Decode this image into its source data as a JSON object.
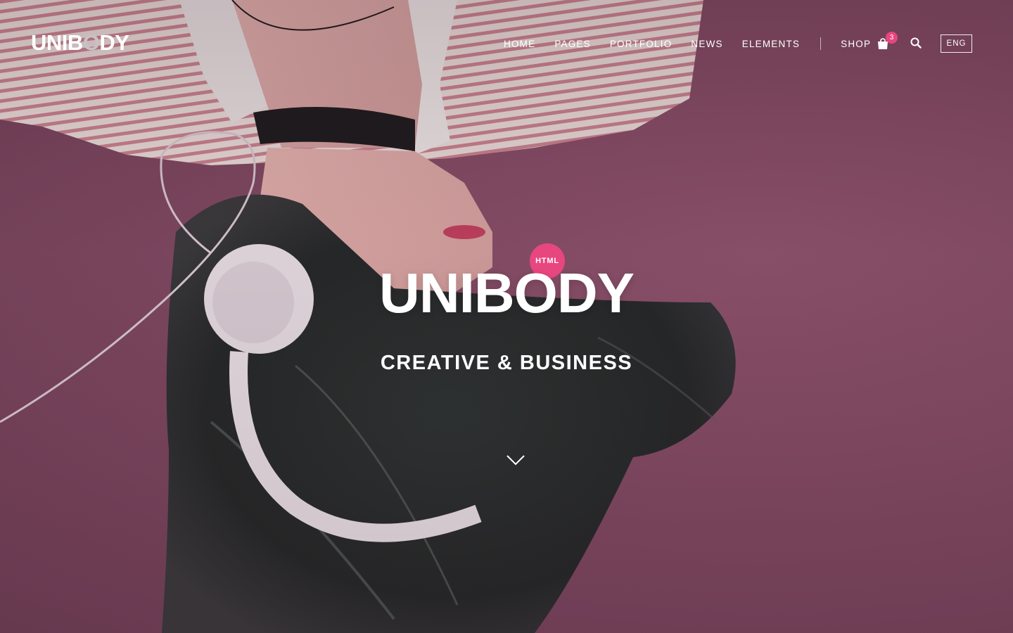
{
  "brand": {
    "logo_text_part1": "UNIB",
    "logo_text_o": "O",
    "logo_text_part2": "DY"
  },
  "nav": {
    "items": [
      "HOME",
      "PAGES",
      "PORTFOLIO",
      "NEWS",
      "ELEMENTS"
    ],
    "shop_label": "SHOP",
    "cart_count": "3",
    "language": "ENG"
  },
  "hero": {
    "badge": "HTML",
    "title": "UNIBODY",
    "subtitle": "CREATIVE & BUSINESS"
  },
  "icons": {
    "cart": "shopping-bag-icon",
    "search": "search-icon",
    "scroll": "chevron-down-icon"
  },
  "colors": {
    "accent": "#e8467f",
    "background": "#7e4861"
  }
}
